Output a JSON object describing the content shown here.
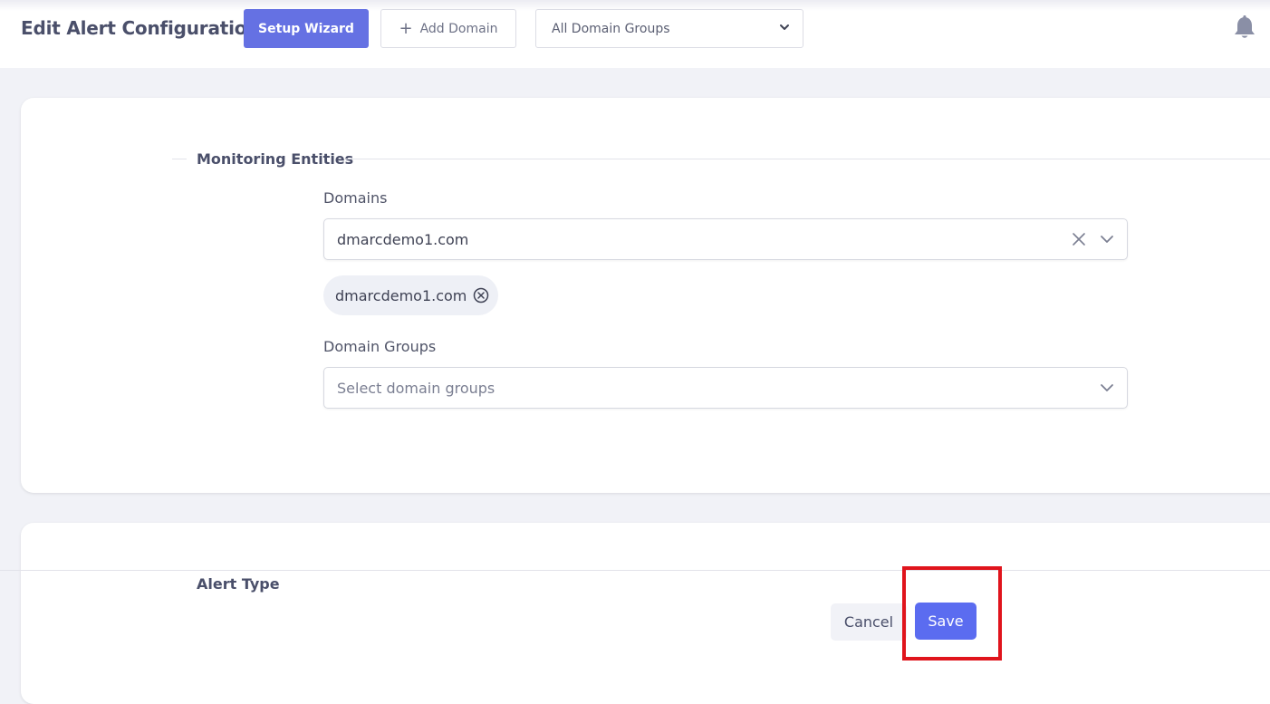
{
  "header": {
    "title": "Edit Alert Configuration",
    "setup_wizard_label": "Setup Wizard",
    "add_domain_label": "Add Domain",
    "domain_group_filter": "All Domain Groups"
  },
  "monitoring": {
    "section_title": "Monitoring Entities",
    "domains_label": "Domains",
    "domains_value": "dmarcdemo1.com",
    "selected_chip": "dmarcdemo1.com",
    "domain_groups_label": "Domain Groups",
    "domain_groups_placeholder": "Select domain groups"
  },
  "alert": {
    "section_title": "Alert Type"
  },
  "actions": {
    "cancel_label": "Cancel",
    "save_label": "Save"
  },
  "colors": {
    "primary": "#6571e3",
    "save": "#5b6cf0",
    "highlight": "#e0141c"
  }
}
